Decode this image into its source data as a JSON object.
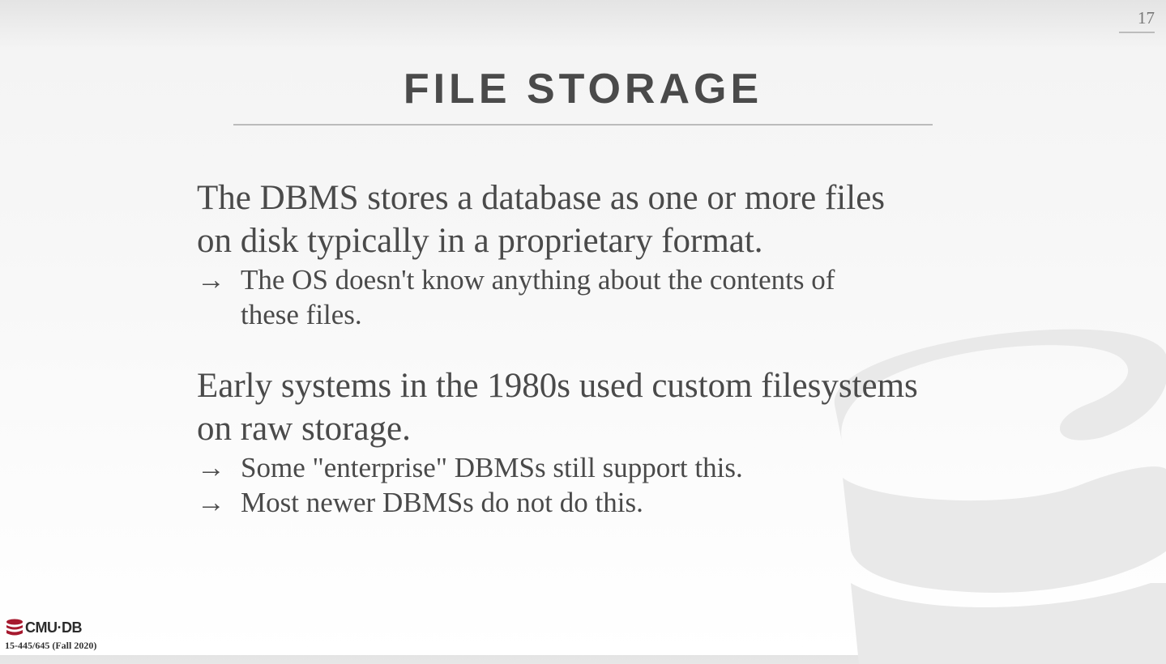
{
  "page_number": "17",
  "title": "FILE STORAGE",
  "sections": [
    {
      "main": [
        "The DBMS stores a database as one or more files",
        "on disk typically in a proprietary format."
      ],
      "subs": [
        [
          "The OS doesn't know anything about the contents of",
          "these files."
        ]
      ]
    },
    {
      "main": [
        "Early systems in the 1980s used custom filesystems",
        "on raw storage."
      ],
      "subs": [
        [
          "Some \"enterprise\" DBMSs still support this."
        ],
        [
          "Most newer DBMSs do not do this."
        ]
      ]
    }
  ],
  "arrow_glyph": "→",
  "footer": {
    "logo_text": "CMU·DB",
    "course": "15-445/645 (Fall 2020)",
    "logo_icon": "database-icon",
    "logo_color": "#a6192e"
  },
  "background_icon": "database-watermark-icon"
}
